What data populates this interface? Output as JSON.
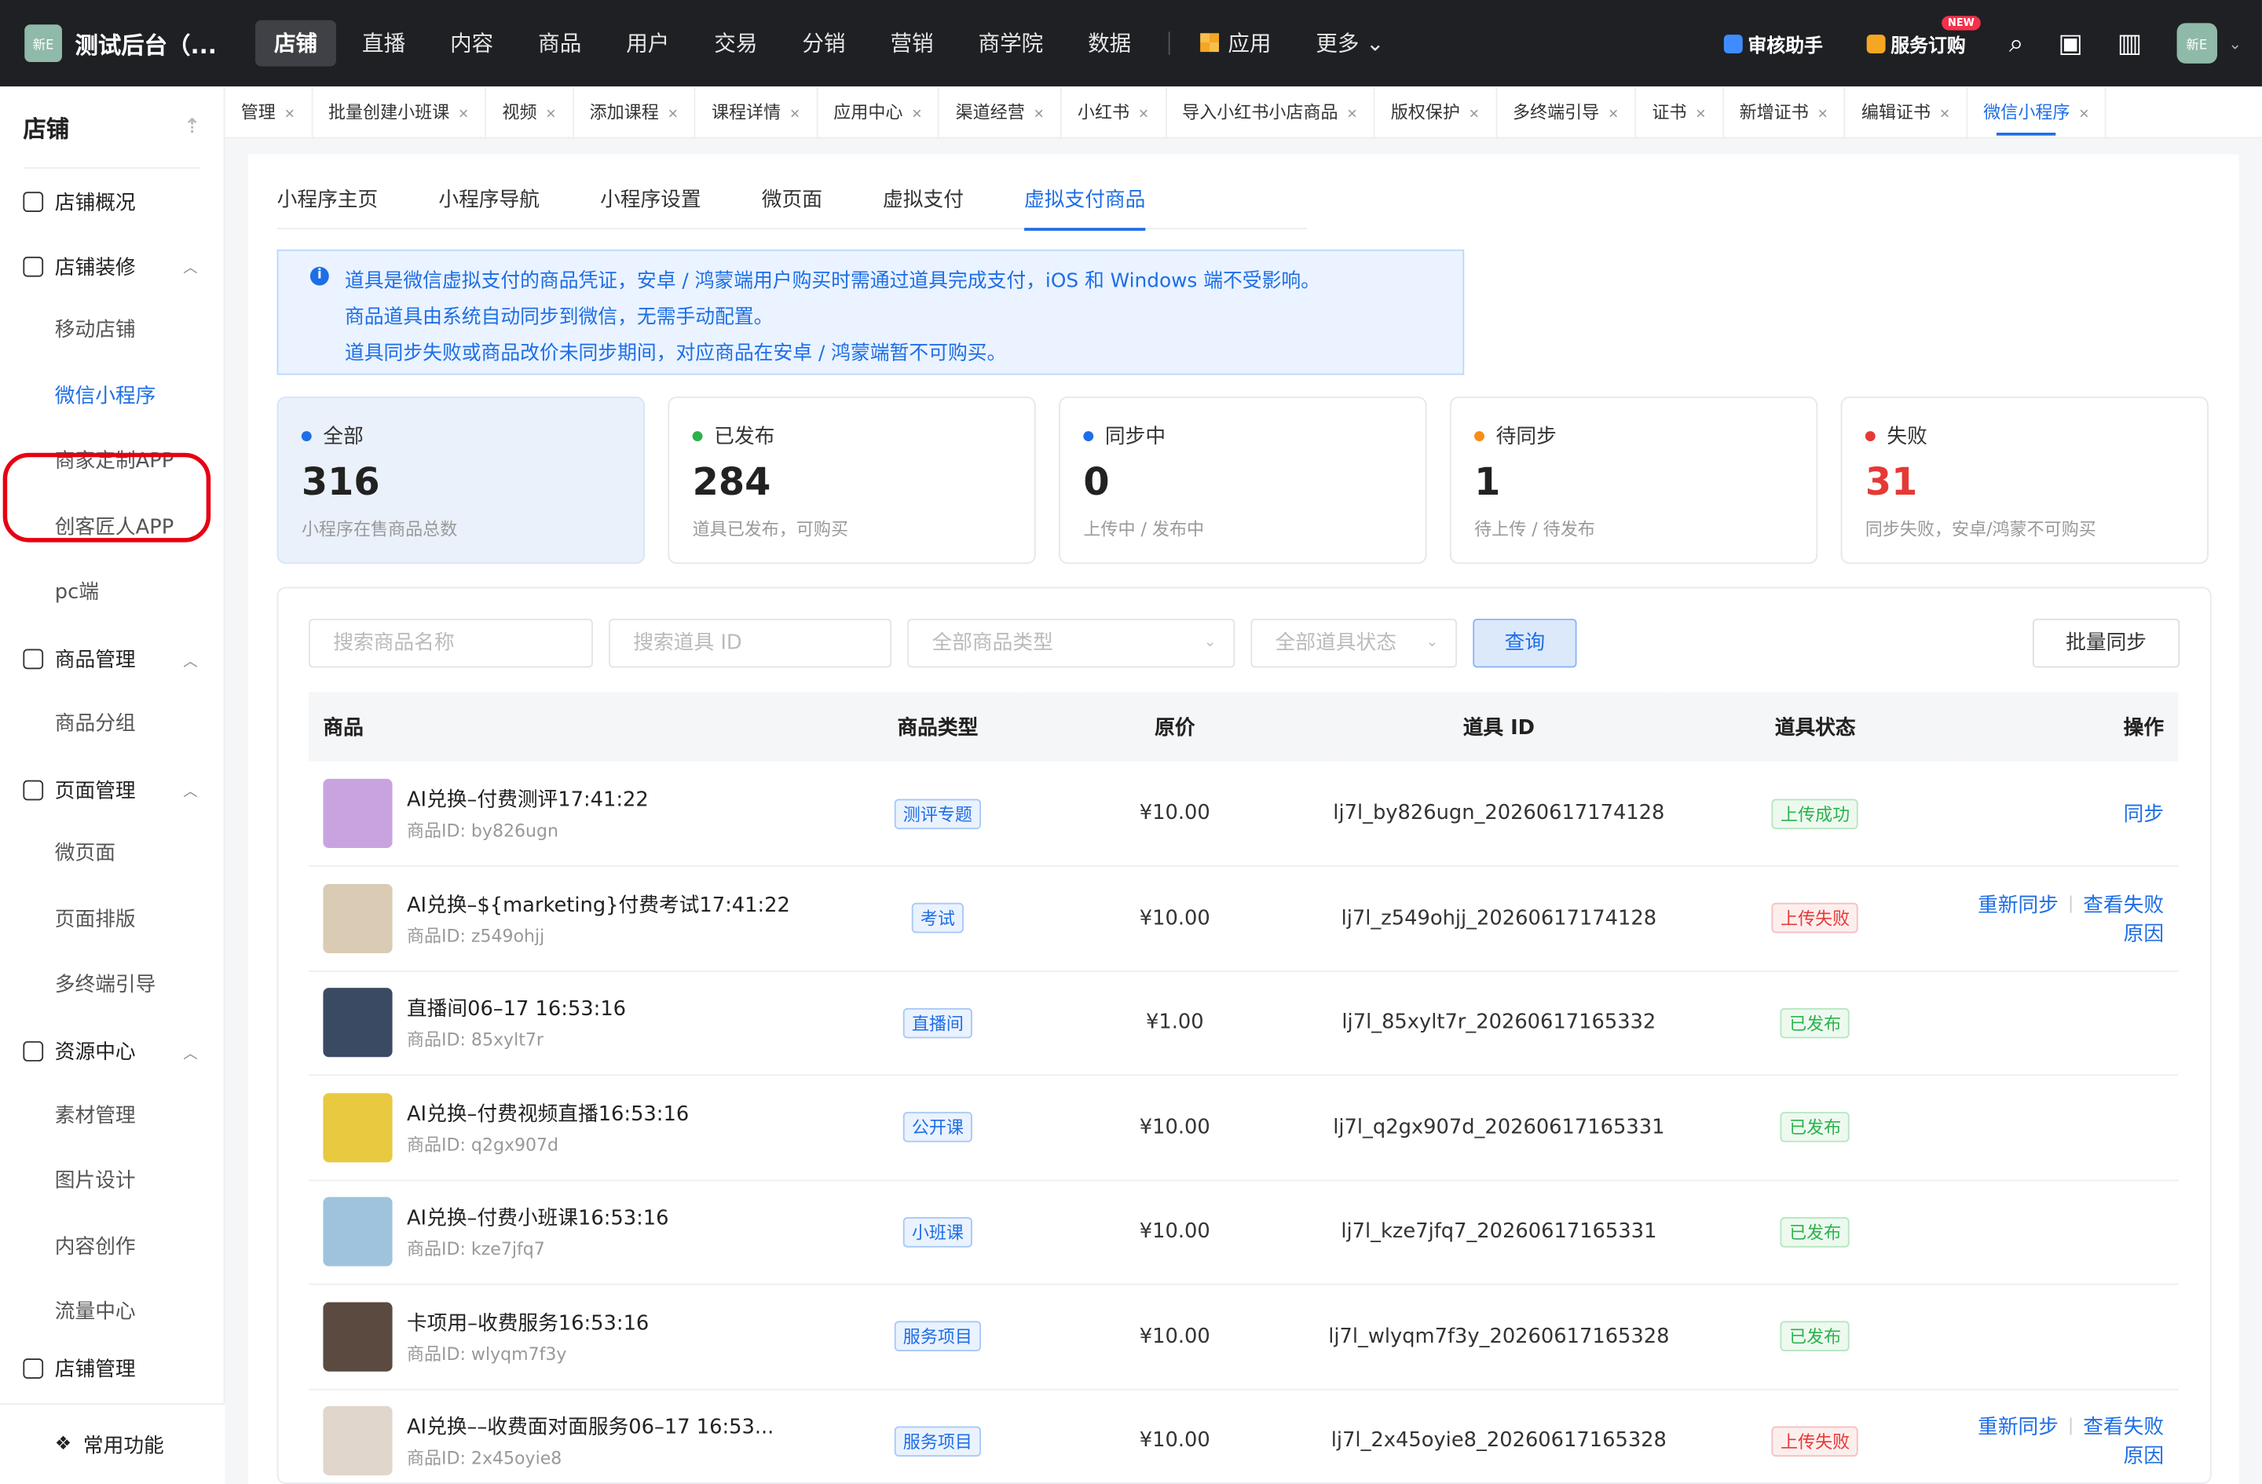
{
  "app": {
    "logo_text": "新E",
    "title": "测试后台（..."
  },
  "nav": [
    {
      "label": "店铺",
      "active": true
    },
    {
      "label": "直播"
    },
    {
      "label": "内容"
    },
    {
      "label": "商品"
    },
    {
      "label": "用户"
    },
    {
      "label": "交易"
    },
    {
      "label": "分销"
    },
    {
      "label": "营销"
    },
    {
      "label": "商学院"
    },
    {
      "label": "数据"
    }
  ],
  "nav_app": "应用",
  "nav_more": "更多",
  "topright": {
    "audit": "审核助手",
    "subscribe": "服务订购",
    "new_badge": "NEW",
    "avatar": "新E"
  },
  "sidebar": {
    "title": "店铺",
    "groups": [
      {
        "label": "店铺概况"
      },
      {
        "label": "店铺装修",
        "items": [
          "移动店铺",
          "微信小程序",
          "商家定制APP",
          "创客匠人APP",
          "pc端"
        ]
      },
      {
        "label": "商品管理",
        "items": [
          "商品分组"
        ]
      },
      {
        "label": "页面管理",
        "items": [
          "微页面",
          "页面排版",
          "多终端引导"
        ]
      },
      {
        "label": "资源中心",
        "items": [
          "素材管理",
          "图片设计",
          "内容创作",
          "流量中心"
        ]
      },
      {
        "label": "店铺管理"
      }
    ],
    "selected": "微信小程序",
    "common": "常用功能"
  },
  "tabs": [
    "管理",
    "批量创建小班课",
    "视频",
    "添加课程",
    "课程详情",
    "应用中心",
    "渠道经营",
    "小红书",
    "导入小红书小店商品",
    "版权保护",
    "多终端引导",
    "证书",
    "新增证书",
    "编辑证书",
    "微信小程序"
  ],
  "subtabs": [
    "小程序主页",
    "小程序导航",
    "小程序设置",
    "微页面",
    "虚拟支付",
    "虚拟支付商品"
  ],
  "notice": [
    "道具是微信虚拟支付的商品凭证，安卓 / 鸿蒙端用户购买时需通过道具完成支付，iOS 和 Windows 端不受影响。",
    "商品道具由系统自动同步到微信，无需手动配置。",
    "道具同步失败或商品改价未同步期间，对应商品在安卓 / 鸿蒙端暂不可购买。"
  ],
  "stats": [
    {
      "label": "全部",
      "value": "316",
      "desc": "小程序在售商品总数",
      "color": "#1e6ee6"
    },
    {
      "label": "已发布",
      "value": "284",
      "desc": "道具已发布，可购买",
      "color": "#2bb24c"
    },
    {
      "label": "同步中",
      "value": "0",
      "desc": "上传中 / 发布中",
      "color": "#1e6ee6"
    },
    {
      "label": "待同步",
      "value": "1",
      "desc": "待上传 / 待发布",
      "color": "#fa8c16"
    },
    {
      "label": "失败",
      "value": "31",
      "desc": "同步失败，安卓/鸿蒙不可购买",
      "color": "#e53935"
    }
  ],
  "filters": {
    "name_ph": "搜索商品名称",
    "id_ph": "搜索道具 ID",
    "type_ph": "全部商品类型",
    "status_ph": "全部道具状态",
    "query": "查询",
    "batch": "批量同步"
  },
  "table": {
    "headers": [
      "商品",
      "商品类型",
      "原价",
      "道具 ID",
      "道具状态",
      "操作"
    ],
    "rows": [
      {
        "name": "AI兑换–付费测评17:41:22",
        "pid": "商品ID: by826ugn",
        "type": "测评专题",
        "price": "¥10.00",
        "tid": "lj7l_by826ugn_20260617174128",
        "status": "上传成功",
        "ok": true,
        "ops": [
          "同步"
        ],
        "thumb": "#c9a3e0"
      },
      {
        "name": "AI兑换–${marketing}付费考试17:41:22",
        "pid": "商品ID: z549ohjj",
        "type": "考试",
        "price": "¥10.00",
        "tid": "lj7l_z549ohjj_20260617174128",
        "status": "上传失败",
        "ok": false,
        "ops": [
          "重新同步",
          "查看失败原因"
        ],
        "thumb": "#d9cbb4"
      },
      {
        "name": "直播间06–17 16:53:16",
        "pid": "商品ID: 85xylt7r",
        "type": "直播间",
        "price": "¥1.00",
        "tid": "lj7l_85xylt7r_20260617165332",
        "status": "已发布",
        "ok": true,
        "ops": [],
        "thumb": "#3b4a63"
      },
      {
        "name": "AI兑换–付费视频直播16:53:16",
        "pid": "商品ID: q2gx907d",
        "type": "公开课",
        "price": "¥10.00",
        "tid": "lj7l_q2gx907d_20260617165331",
        "status": "已发布",
        "ok": true,
        "ops": [],
        "thumb": "#e8c940"
      },
      {
        "name": "AI兑换–付费小班课16:53:16",
        "pid": "商品ID: kze7jfq7",
        "type": "小班课",
        "price": "¥10.00",
        "tid": "lj7l_kze7jfq7_20260617165331",
        "status": "已发布",
        "ok": true,
        "ops": [],
        "thumb": "#9fc3dc"
      },
      {
        "name": "卡项用–收费服务16:53:16",
        "pid": "商品ID: wlyqm7f3y",
        "type": "服务项目",
        "price": "¥10.00",
        "tid": "lj7l_wlyqm7f3y_20260617165328",
        "status": "已发布",
        "ok": true,
        "ops": [],
        "thumb": "#5a4a40"
      },
      {
        "name": "AI兑换––收费面对面服务06–17 16:53...",
        "pid": "商品ID: 2x45oyie8",
        "type": "服务项目",
        "price": "¥10.00",
        "tid": "lj7l_2x45oyie8_20260617165328",
        "status": "上传失败",
        "ok": false,
        "ops": [
          "重新同步",
          "查看失败原因"
        ],
        "thumb": "#e0d6cc"
      }
    ]
  }
}
